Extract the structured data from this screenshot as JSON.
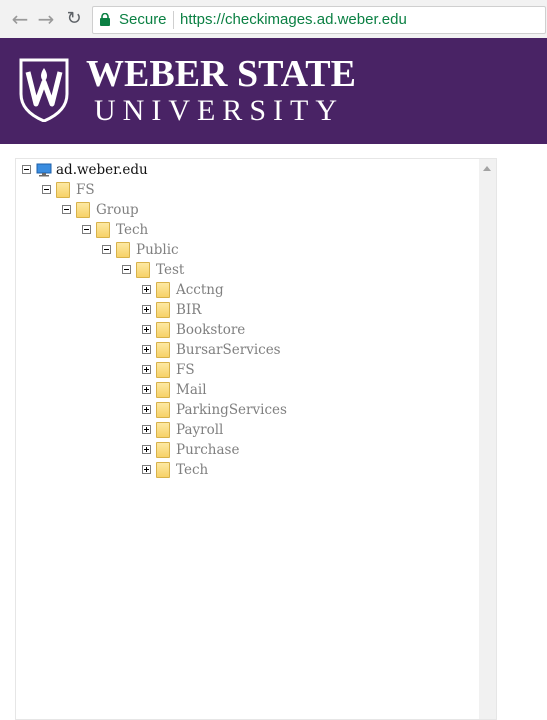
{
  "browser": {
    "secure_label": "Secure",
    "url": "https://checkimages.ad.weber.edu"
  },
  "banner": {
    "line1": "WEBER STATE",
    "line2": "UNIVERSITY",
    "background": "#492365"
  },
  "tree": {
    "root": "ad.weber.edu",
    "path": [
      "FS",
      "Group",
      "Tech",
      "Public",
      "Test"
    ],
    "children": [
      "Acctng",
      "BIR",
      "Bookstore",
      "BursarServices",
      "FS",
      "Mail",
      "ParkingServices",
      "Payroll",
      "Purchase",
      "Tech"
    ]
  }
}
